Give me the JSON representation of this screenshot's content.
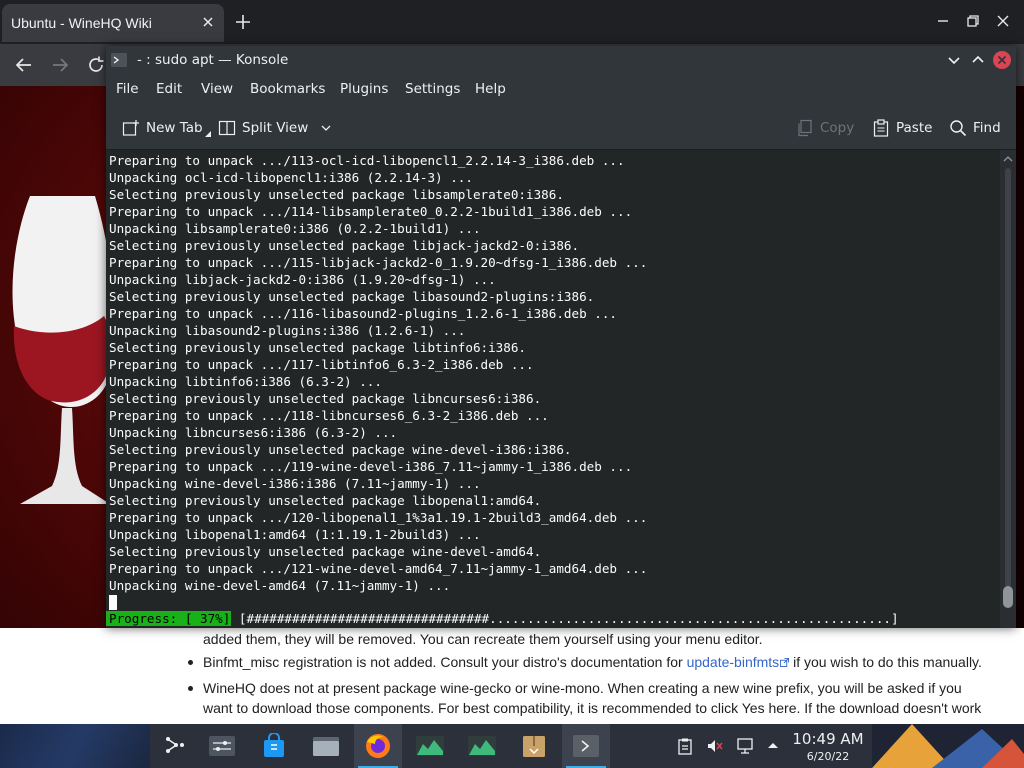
{
  "browser": {
    "tab_title": "Ubuntu - WineHQ Wiki"
  },
  "konsole": {
    "title": "- : sudo apt — Konsole",
    "menu": [
      "File",
      "Edit",
      "View",
      "Bookmarks",
      "Plugins",
      "Settings",
      "Help"
    ],
    "toolbar": {
      "new_tab": "New Tab",
      "split_view": "Split View",
      "copy": "Copy",
      "paste": "Paste",
      "find": "Find"
    },
    "terminal_lines": [
      "Preparing to unpack .../113-ocl-icd-libopencl1_2.2.14-3_i386.deb ...",
      "Unpacking ocl-icd-libopencl1:i386 (2.2.14-3) ...",
      "Selecting previously unselected package libsamplerate0:i386.",
      "Preparing to unpack .../114-libsamplerate0_0.2.2-1build1_i386.deb ...",
      "Unpacking libsamplerate0:i386 (0.2.2-1build1) ...",
      "Selecting previously unselected package libjack-jackd2-0:i386.",
      "Preparing to unpack .../115-libjack-jackd2-0_1.9.20~dfsg-1_i386.deb ...",
      "Unpacking libjack-jackd2-0:i386 (1.9.20~dfsg-1) ...",
      "Selecting previously unselected package libasound2-plugins:i386.",
      "Preparing to unpack .../116-libasound2-plugins_1.2.6-1_i386.deb ...",
      "Unpacking libasound2-plugins:i386 (1.2.6-1) ...",
      "Selecting previously unselected package libtinfo6:i386.",
      "Preparing to unpack .../117-libtinfo6_6.3-2_i386.deb ...",
      "Unpacking libtinfo6:i386 (6.3-2) ...",
      "Selecting previously unselected package libncurses6:i386.",
      "Preparing to unpack .../118-libncurses6_6.3-2_i386.deb ...",
      "Unpacking libncurses6:i386 (6.3-2) ...",
      "Selecting previously unselected package wine-devel-i386:i386.",
      "Preparing to unpack .../119-wine-devel-i386_7.11~jammy-1_i386.deb ...",
      "Unpacking wine-devel-i386:i386 (7.11~jammy-1) ...",
      "Selecting previously unselected package libopenal1:amd64.",
      "Preparing to unpack .../120-libopenal1_1%3a1.19.1-2build3_amd64.deb ...",
      "Unpacking libopenal1:amd64 (1:1.19.1-2build3) ...",
      "Selecting previously unselected package wine-devel-amd64.",
      "Preparing to unpack .../121-wine-devel-amd64_7.11~jammy-1_amd64.deb ...",
      "Unpacking wine-devel-amd64 (7.11~jammy-1) ..."
    ],
    "progress": {
      "label": "Progress: [ 37%]",
      "bar": "[################################.....................................................]",
      "percent": 37
    }
  },
  "wiki": {
    "fragment": "added them, they will be removed. You can recreate them yourself using your menu editor.",
    "bullet1_before": "Binfmt_misc registration is not added. Consult your distro's documentation for ",
    "bullet1_link": "update-binfmts",
    "bullet1_after": " if you wish to do this manually.",
    "bullet2": "WineHQ does not at present package wine-gecko or wine-mono. When creating a new wine prefix, you will be asked if you want to download those components. For best compatibility, it is recommended to click Yes here. If the download doesn't work"
  },
  "taskbar": {
    "clock_time": "10:49 AM",
    "clock_date": "6/20/22"
  }
}
